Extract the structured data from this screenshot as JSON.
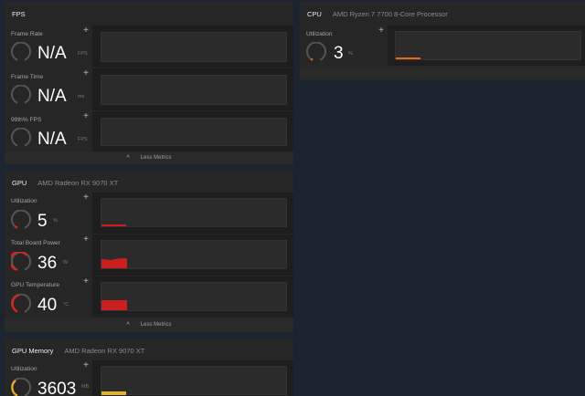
{
  "fps": {
    "title": "FPS",
    "metrics": [
      {
        "label": "Frame Rate",
        "value": "N/A",
        "unit": "FPS"
      },
      {
        "label": "Frame Time",
        "value": "N/A",
        "unit": "ms"
      },
      {
        "label": "99th% FPS",
        "value": "N/A",
        "unit": "FPS"
      }
    ],
    "less_label": "Less Metrics"
  },
  "gpu": {
    "title": "GPU",
    "subtitle": "AMD Radeon RX 9070 XT",
    "metrics": [
      {
        "label": "Utilization",
        "value": "5",
        "unit": "%",
        "level": 0.05
      },
      {
        "label": "Total Board Power",
        "value": "36",
        "unit": "W",
        "level": 0.7
      },
      {
        "label": "GPU Temperature",
        "value": "40",
        "unit": "°C",
        "level": 0.45
      }
    ],
    "less_label": "Less Metrics"
  },
  "gpu_memory": {
    "title": "GPU Memory",
    "subtitle": "AMD Radeon RX 9070 XT",
    "metrics": [
      {
        "label": "Utilization",
        "value": "3603",
        "unit": "MB"
      }
    ]
  },
  "cpu": {
    "title": "CPU",
    "subtitle": "AMD Ryzen 7 7700 8-Core Processor",
    "metrics": [
      {
        "label": "Utilization",
        "value": "3",
        "unit": "%",
        "level": 0.03
      }
    ]
  },
  "icons": {
    "plus": "+",
    "chevron_up": "^"
  },
  "colors": {
    "gpu_accent": "#e02020",
    "cpu_accent": "#e8671c",
    "memory_accent": "#e6b325",
    "gauge_track": "#555555"
  }
}
